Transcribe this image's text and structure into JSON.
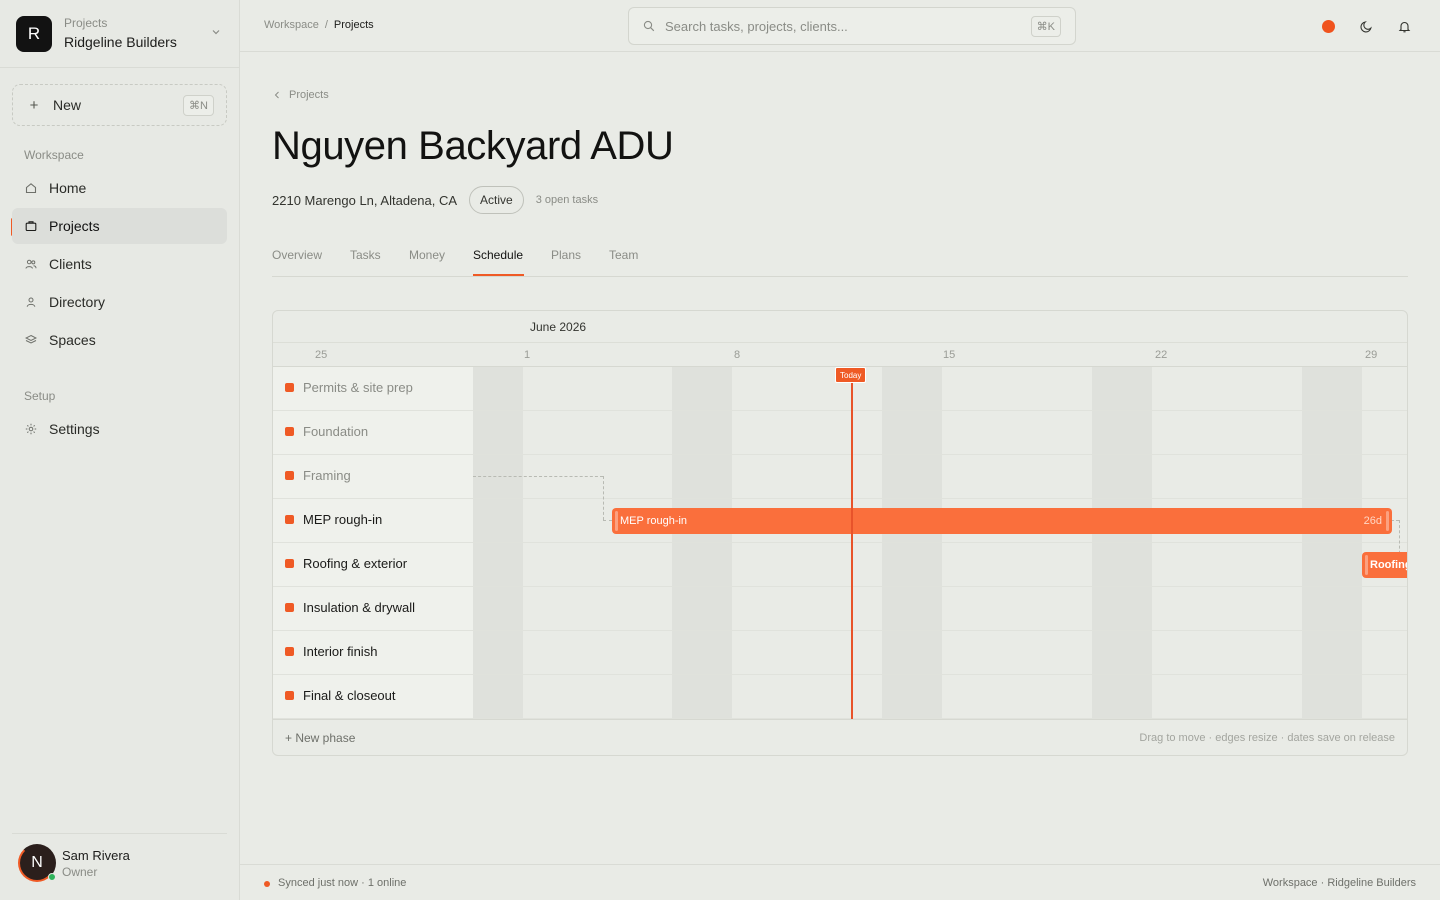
{
  "sidebar": {
    "org_kicker": "Projects",
    "org_name": "Ridgeline Builders",
    "org_initial": "R",
    "new_label": "New",
    "new_shortcut": "⌘N",
    "section_workspace": "Workspace",
    "section_setup": "Setup",
    "items": [
      {
        "label": "Home",
        "icon": "home-icon"
      },
      {
        "label": "Projects",
        "icon": "briefcase-icon",
        "active": true
      },
      {
        "label": "Clients",
        "icon": "users-icon"
      },
      {
        "label": "Directory",
        "icon": "person-icon"
      },
      {
        "label": "Spaces",
        "icon": "layers-icon"
      }
    ],
    "setup_items": [
      {
        "label": "Settings",
        "icon": "gear-icon"
      }
    ],
    "user": {
      "initial": "N",
      "name": "Sam Rivera",
      "role": "Owner"
    }
  },
  "topbar": {
    "breadcrumb": [
      "Workspace",
      "Projects"
    ],
    "search_placeholder": "Search tasks, projects, clients...",
    "search_shortcut": "⌘K"
  },
  "project": {
    "back_label": "Projects",
    "title": "Nguyen Backyard ADU",
    "address": "2210 Marengo Ln, Altadena, CA",
    "status": "Active",
    "open_tasks": "3 open tasks"
  },
  "tabs": [
    "Overview",
    "Tasks",
    "Money",
    "Schedule",
    "Plans",
    "Team"
  ],
  "active_tab": "Schedule",
  "schedule": {
    "month": "June 2026",
    "day_labels": [
      "25",
      "1",
      "8",
      "15",
      "22",
      "29"
    ],
    "today_label": "Today",
    "phases": [
      {
        "name": "Permits & site prep",
        "state": "past"
      },
      {
        "name": "Foundation",
        "state": "past"
      },
      {
        "name": "Framing",
        "state": "past"
      },
      {
        "name": "MEP rough-in",
        "state": "upcoming"
      },
      {
        "name": "Roofing & exterior",
        "state": "upcoming"
      },
      {
        "name": "Insulation & drywall",
        "state": "upcoming"
      },
      {
        "name": "Interior finish",
        "state": "upcoming"
      },
      {
        "name": "Final & closeout",
        "state": "upcoming"
      }
    ],
    "bars": [
      {
        "label": "MEP rough-in",
        "duration": "26d"
      },
      {
        "label": "Roofing",
        "duration": ""
      }
    ],
    "new_phase": "+ New phase",
    "hint": "Drag to move · edges resize · dates save on release"
  },
  "statusbar": {
    "sync": "Synced just now · 1 online",
    "workspace": "Workspace · Ridgeline Builders"
  },
  "colors": {
    "accent": "#ef5a25",
    "bar": "#fa6f3c",
    "background": "#e9ebe6"
  }
}
